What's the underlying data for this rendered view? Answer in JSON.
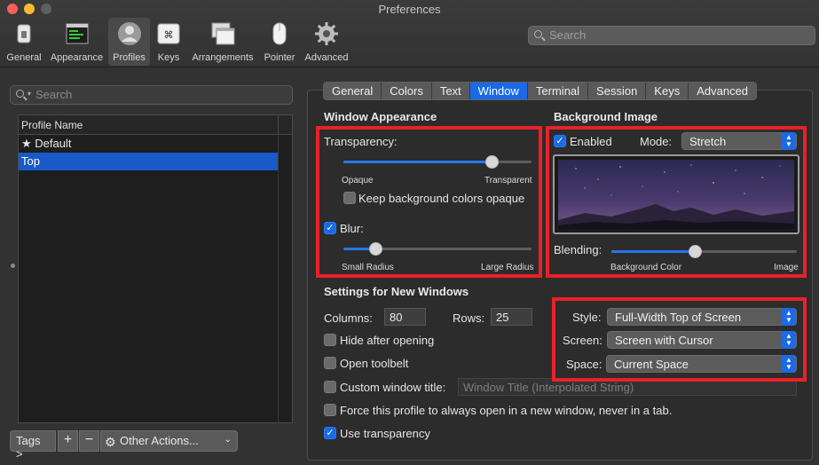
{
  "window": {
    "title": "Preferences"
  },
  "toolbar": {
    "items": [
      {
        "label": "General",
        "icon": "switch-icon"
      },
      {
        "label": "Appearance",
        "icon": "appearance-icon"
      },
      {
        "label": "Profiles",
        "icon": "profile-icon"
      },
      {
        "label": "Keys",
        "icon": "command-key-icon"
      },
      {
        "label": "Arrangements",
        "icon": "arrangements-icon"
      },
      {
        "label": "Pointer",
        "icon": "mouse-icon"
      },
      {
        "label": "Advanced",
        "icon": "gear-icon"
      }
    ],
    "selected": "Profiles",
    "search_placeholder": "Search"
  },
  "sidebar": {
    "search_placeholder": "Search",
    "column_header": "Profile Name",
    "profiles": [
      {
        "name": "Default",
        "prefix": "★ "
      },
      {
        "name": "Top",
        "prefix": ""
      }
    ],
    "selected": "Top",
    "buttons": {
      "tags": "Tags >",
      "add": "+",
      "remove": "−",
      "other_actions": "Other Actions..."
    }
  },
  "tabs": {
    "items": [
      "General",
      "Colors",
      "Text",
      "Window",
      "Terminal",
      "Session",
      "Keys",
      "Advanced"
    ],
    "active": "Window"
  },
  "window_appearance": {
    "heading": "Window Appearance",
    "transparency_label": "Transparency:",
    "transparency_value": 0.79,
    "transparency_min_label": "Opaque",
    "transparency_max_label": "Transparent",
    "keep_bg_opaque_label": "Keep background colors opaque",
    "keep_bg_opaque_checked": false,
    "blur_label": "Blur:",
    "blur_checked": true,
    "blur_value": 0.17,
    "blur_min_label": "Small Radius",
    "blur_max_label": "Large Radius"
  },
  "background_image": {
    "heading": "Background Image",
    "enabled_label": "Enabled",
    "enabled_checked": true,
    "mode_label": "Mode:",
    "mode_value": "Stretch",
    "blending_label": "Blending:",
    "blending_value": 0.45,
    "blending_min_label": "Background Color",
    "blending_max_label": "Image"
  },
  "new_windows": {
    "heading": "Settings for New Windows",
    "columns_label": "Columns:",
    "columns_value": "80",
    "rows_label": "Rows:",
    "rows_value": "25",
    "hide_after_opening_label": "Hide after opening",
    "hide_after_opening_checked": false,
    "open_toolbelt_label": "Open toolbelt",
    "open_toolbelt_checked": false,
    "custom_title_label": "Custom window title:",
    "custom_title_checked": false,
    "custom_title_placeholder": "Window Title (Interpolated String)",
    "force_new_window_label": "Force this profile to always open in a new window, never in a tab.",
    "force_new_window_checked": false,
    "use_transparency_label": "Use transparency",
    "use_transparency_checked": true,
    "style_label": "Style:",
    "style_value": "Full-Width Top of Screen",
    "screen_label": "Screen:",
    "screen_value": "Screen with Cursor",
    "space_label": "Space:",
    "space_value": "Current Space"
  },
  "colors": {
    "accent": "#1a6ae8",
    "highlight_box": "#e8212a",
    "selection": "#1959c8"
  }
}
